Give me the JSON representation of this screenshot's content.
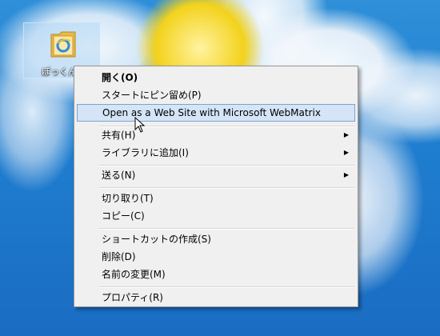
{
  "desktop": {
    "icon_label": "ぽっくんだ"
  },
  "menu": {
    "open": "開く(O)",
    "pin_start": "スタートにピン留め(P)",
    "open_webmatrix": "Open as a Web Site with Microsoft WebMatrix",
    "share": "共有(H)",
    "add_library": "ライブラリに追加(I)",
    "send_to": "送る(N)",
    "cut": "切り取り(T)",
    "copy": "コピー(C)",
    "create_shortcut": "ショートカットの作成(S)",
    "delete": "削除(D)",
    "rename": "名前の変更(M)",
    "properties": "プロパティ(R)",
    "submenu_arrow": "▶"
  },
  "colors": {
    "wallpaper_blue": "#1f7fd0",
    "menu_background": "#f0f0f0",
    "hover_fill": "#d5e4f6",
    "hover_border": "#7da2ce"
  },
  "icons": {
    "desktop_icon": "folder-with-ie-icon",
    "cursor": "arrow-cursor-icon"
  }
}
